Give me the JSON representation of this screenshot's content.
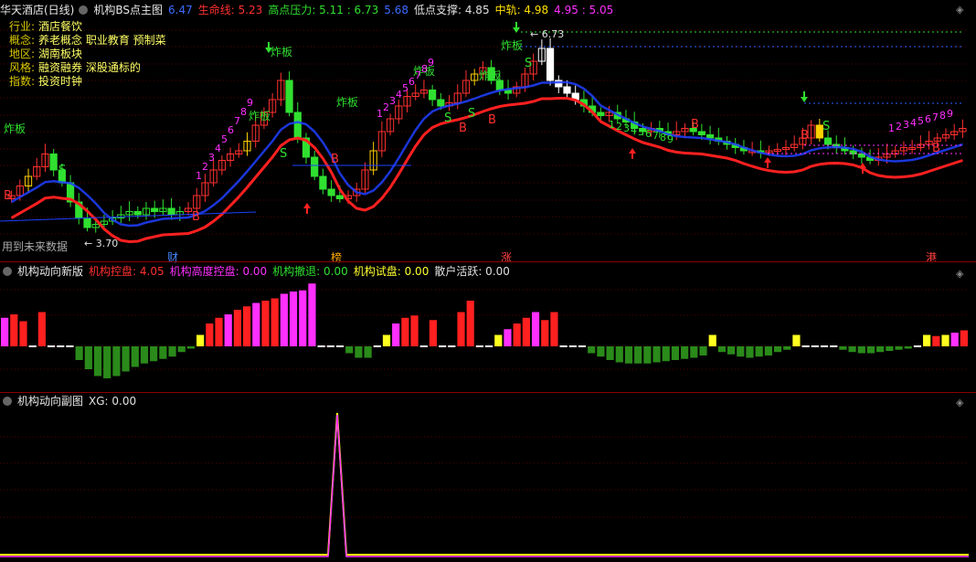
{
  "header_main": {
    "title": "华天酒店(日线)",
    "indicator": "机构BS点主图",
    "items": [
      {
        "label": "",
        "value": "6.47",
        "color": "#3d6bff"
      },
      {
        "label": "生命线:",
        "value": "5.23",
        "color": "#ff3030"
      },
      {
        "label": "高点压力:",
        "value": "5.11 : 6.73",
        "color": "#30e030"
      },
      {
        "label": "",
        "value": "5.68",
        "color": "#3d6bff"
      },
      {
        "label": "低点支撑:",
        "value": "4.85",
        "color": "#e0e0e0"
      },
      {
        "label": "中轨:",
        "value": "4.98",
        "color": "#ffe000"
      },
      {
        "label": "",
        "value": "4.95 : 5.05",
        "color": "#ff30ff"
      }
    ]
  },
  "info": [
    {
      "k": "行业:",
      "v": "酒店餐饮"
    },
    {
      "k": "概念:",
      "v": "养老概念 职业教育 预制菜"
    },
    {
      "k": "地区:",
      "v": "湖南板块"
    },
    {
      "k": "风格:",
      "v": "融资融券 深股通标的"
    },
    {
      "k": "指数:",
      "v": "投资时钟"
    }
  ],
  "footnote": "用到未来数据",
  "bottom_marks": [
    {
      "text": "财",
      "color": "#4488ff"
    },
    {
      "text": "榜",
      "color": "#ffaa00"
    },
    {
      "text": "涨",
      "color": "#ff4040"
    },
    {
      "text": "港",
      "color": "#ff4040"
    }
  ],
  "header_sub1": {
    "indicator": "机构动向新版",
    "items": [
      {
        "label": "机构控盘:",
        "value": "4.05",
        "color": "#ff3030"
      },
      {
        "label": "机构高度控盘:",
        "value": "0.00",
        "color": "#ff30ff"
      },
      {
        "label": "机构撤退:",
        "value": "0.00",
        "color": "#30e030"
      },
      {
        "label": "机构试盘:",
        "value": "0.00",
        "color": "#ffff30"
      },
      {
        "label": "散户活跃:",
        "value": "0.00",
        "color": "#e0e0e0"
      }
    ]
  },
  "header_sub2": {
    "indicator": "机构动向副图",
    "items": [
      {
        "label": "XG:",
        "value": "0.00",
        "color": "#e0e0e0"
      }
    ]
  },
  "annotations": {
    "high_label": "6.73",
    "low_label": "3.70",
    "zhaban": "炸板",
    "buy": "B",
    "sell": "S"
  },
  "chart_data": {
    "type": "candlestick",
    "price_range": [
      3.5,
      7.0
    ],
    "closes": [
      4.3,
      4.45,
      4.6,
      4.75,
      4.95,
      4.7,
      4.5,
      4.2,
      3.95,
      3.8,
      3.85,
      3.9,
      3.95,
      4.0,
      4.05,
      4.0,
      4.1,
      4.05,
      4.1,
      4.0,
      4.05,
      4.1,
      4.3,
      4.5,
      4.7,
      4.85,
      4.95,
      5.0,
      5.15,
      5.4,
      5.6,
      5.8,
      6.1,
      5.6,
      5.2,
      4.9,
      4.6,
      4.4,
      4.3,
      4.25,
      4.3,
      4.4,
      4.7,
      5.0,
      5.3,
      5.5,
      5.7,
      5.85,
      5.9,
      5.95,
      5.8,
      5.7,
      5.75,
      5.9,
      6.1,
      6.2,
      6.3,
      6.1,
      5.95,
      5.9,
      6.0,
      6.2,
      6.4,
      6.6,
      6.1,
      6.0,
      5.9,
      5.8,
      5.7,
      5.6,
      5.55,
      5.6,
      5.5,
      5.45,
      5.35,
      5.3,
      5.35,
      5.3,
      5.25,
      5.3,
      5.35,
      5.3,
      5.25,
      5.2,
      5.15,
      5.1,
      5.05,
      5.0,
      5.0,
      4.98,
      5.0,
      5.02,
      5.05,
      5.1,
      5.2,
      5.4,
      5.2,
      5.1,
      5.05,
      5.0,
      4.95,
      4.9,
      4.85,
      4.9,
      4.95,
      5.0,
      5.05,
      5.05,
      5.1,
      5.15,
      5.2,
      5.25,
      5.3,
      5.35
    ],
    "sub1_values": [
      2.5,
      2.8,
      2.2,
      -0.1,
      3.0,
      -0.1,
      -0.1,
      -0.1,
      -1.2,
      -2.0,
      -2.6,
      -2.8,
      -2.6,
      -2.2,
      -1.8,
      -1.5,
      -1.3,
      -1.1,
      -0.9,
      -0.5,
      -0.2,
      1.0,
      2.0,
      2.5,
      2.8,
      3.2,
      3.5,
      3.8,
      4.0,
      4.2,
      4.6,
      4.8,
      4.9,
      5.5,
      -0.1,
      -0.1,
      -0.1,
      -0.6,
      -1.0,
      -1.0,
      -0.1,
      1.0,
      2.0,
      2.5,
      2.7,
      -0.1,
      2.3,
      -0.1,
      -0.1,
      3.0,
      4.0,
      -0.1,
      -0.1,
      1.0,
      1.5,
      2.0,
      2.5,
      3.0,
      2.3,
      3.0,
      -0.1,
      -0.1,
      -0.1,
      -0.6,
      -0.9,
      -1.2,
      -1.4,
      -1.5,
      -1.5,
      -1.5,
      -1.4,
      -1.3,
      -1.2,
      -1.1,
      -1.0,
      -0.8,
      1.0,
      -0.5,
      -0.7,
      -0.9,
      -1.0,
      -0.9,
      -0.8,
      -0.5,
      -0.3,
      1.0,
      -0.1,
      -0.1,
      -0.1,
      -0.1,
      -0.3,
      -0.5,
      -0.6,
      -0.6,
      -0.5,
      -0.4,
      -0.3,
      -0.2,
      -0.1,
      1.0,
      0.9,
      1.0,
      1.2,
      1.4
    ],
    "sub2_peak": 1
  }
}
